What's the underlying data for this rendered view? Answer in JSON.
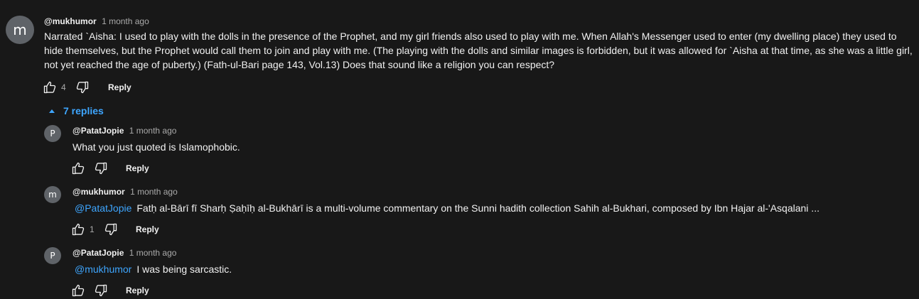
{
  "main_comment": {
    "avatar_letter": "m",
    "author": "@mukhumor",
    "time": "1 month ago",
    "text_lines": [
      "Narrated `Aisha: I used to play with the dolls in the presence of the Prophet, and my girl friends also used to play with me. When Allah's Messenger  used to enter (my dwelling place) they used to",
      "hide themselves, but the Prophet would call them to join and play with me. (The playing with the dolls and similar images is forbidden, but it was allowed for `Aisha at that time, as she was a little girl,",
      "not yet reached the age of puberty.) (Fath-ul-Bari page 143, Vol.13) Does that sound like a religion you can respect?"
    ],
    "like_count": "4",
    "reply_label": "Reply"
  },
  "replies_toggle": {
    "label": "7 replies"
  },
  "replies": [
    {
      "avatar_letter": "P",
      "author": "@PatatJopie",
      "time": "1 month ago",
      "mention": "",
      "text": "What you just quoted is Islamophobic.",
      "like_count": "",
      "reply_label": "Reply"
    },
    {
      "avatar_letter": "m",
      "author": "@mukhumor",
      "time": "1 month ago",
      "mention": "@PatatJopie",
      "text": "Fatḥ al-Bārī fī Sharḥ Ṣaḥīḥ al-Bukhārī is a multi-volume commentary on the Sunni hadith collection Sahih al-Bukhari, composed by Ibn Hajar al-'Asqalani ...",
      "like_count": "1",
      "reply_label": "Reply"
    },
    {
      "avatar_letter": "P",
      "author": "@PatatJopie",
      "time": "1 month ago",
      "mention": "@mukhumor",
      "text": "I was being sarcastic.",
      "like_count": "",
      "reply_label": "Reply"
    }
  ],
  "icons": {
    "like": "thumbs-up-icon",
    "dislike": "thumbs-down-icon",
    "collapse": "caret-up-icon"
  },
  "colors": {
    "background": "#181818",
    "text": "#f1f1f1",
    "secondary": "#aaaaaa",
    "link": "#3ea6ff",
    "avatar": "#5f6368"
  }
}
